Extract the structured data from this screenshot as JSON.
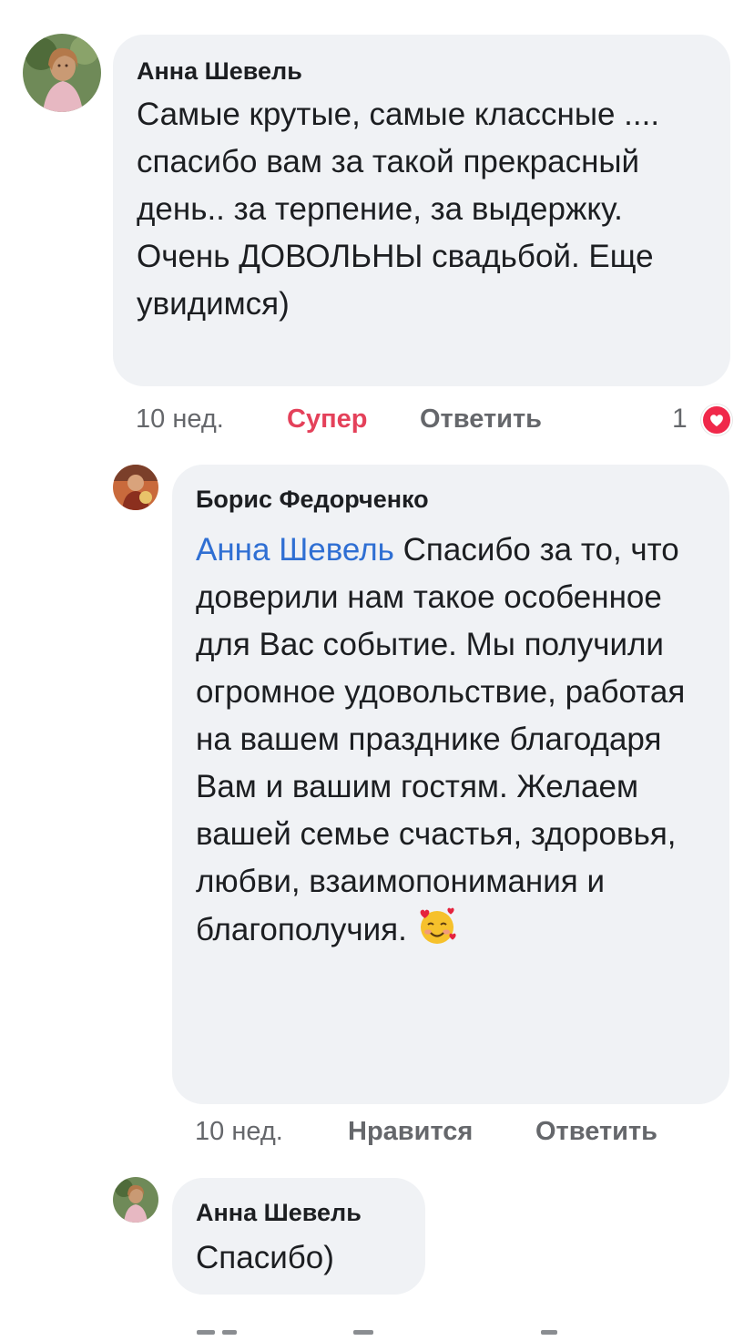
{
  "comments": [
    {
      "author": "Анна Шевель",
      "text": "Самые крутые, самые классные .... спасибо вам за такой прекрасный день.. за терпение, за выдержку. Очень ДОВОЛЬНЫ свадьбой. Еще увидимся)",
      "time": "10 нед.",
      "like_label": "Супер",
      "reply_label": "Ответить",
      "reaction_count": "1",
      "reaction_icon": "heart-icon",
      "liked_color": "#e4415a"
    },
    {
      "author": "Борис Федорченко",
      "mention": "Анна Шевель",
      "text": "Спасибо за то, что доверили нам такое особенное для Вас событие. Мы получили огромное удовольствие, работая на вашем празднике благодаря Вам и вашим гостям. Желаем вашей семье счастья, здоровья, любви, взаимопонимания и благополучия.",
      "emoji": "smiling-face-with-hearts-icon",
      "time": "10 нед.",
      "like_label": "Нравится",
      "reply_label": "Ответить"
    },
    {
      "author": "Анна Шевель",
      "text": "Спасибо)"
    }
  ],
  "colors": {
    "bubble_bg": "#f0f2f5",
    "mention": "#2f6fd3",
    "meta_text": "#65676b"
  }
}
